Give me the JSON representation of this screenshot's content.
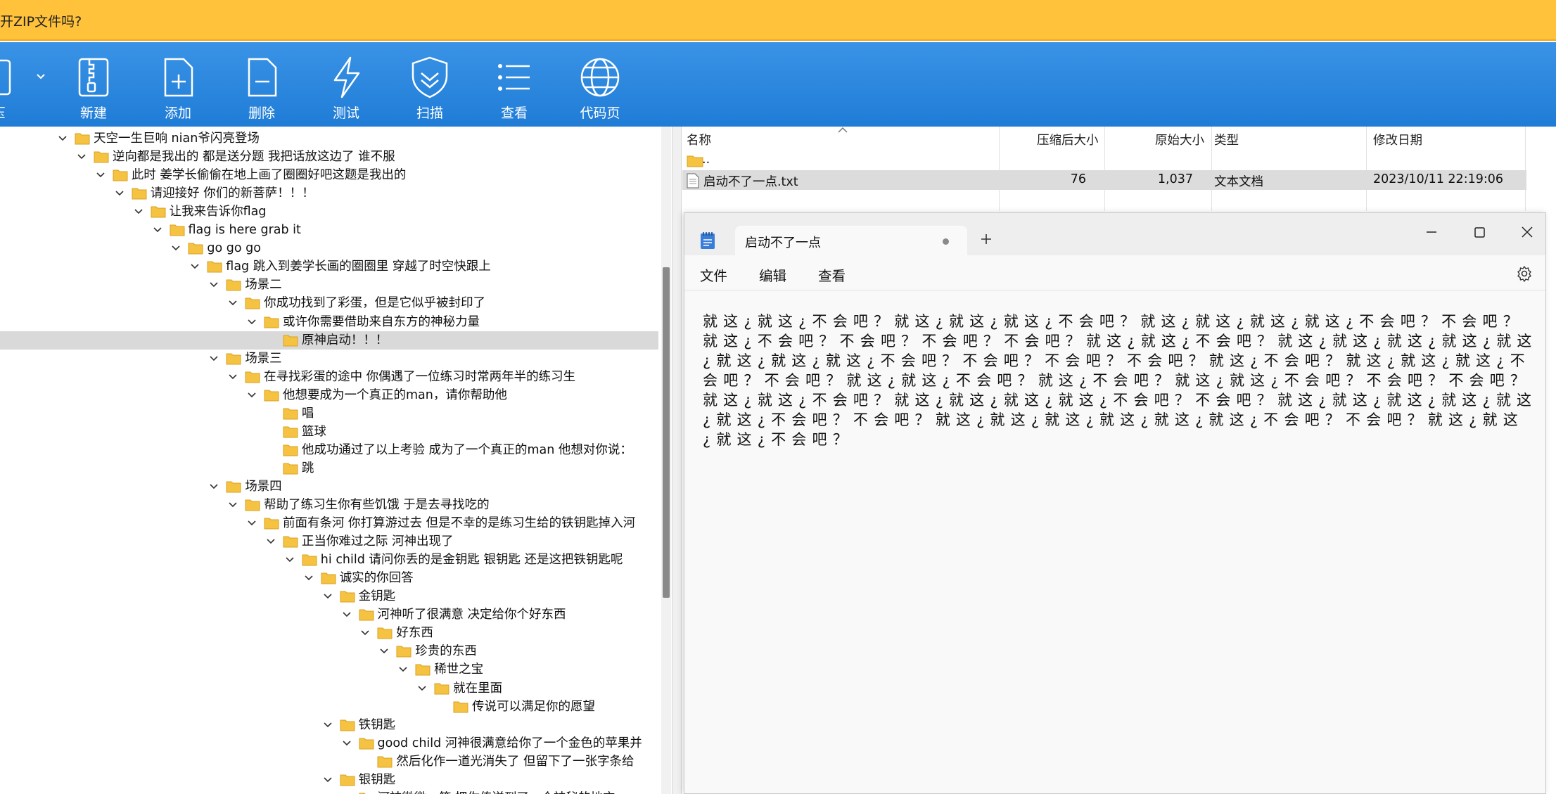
{
  "prompt": {
    "text": "开ZIP文件吗?"
  },
  "toolbar": {
    "buttons": [
      {
        "label": "压",
        "icon": "extract-icon"
      },
      {
        "label": "新建",
        "icon": "zip-archive-icon"
      },
      {
        "label": "添加",
        "icon": "add-file-icon"
      },
      {
        "label": "删除",
        "icon": "delete-file-icon"
      },
      {
        "label": "测试",
        "icon": "lightning-icon"
      },
      {
        "label": "扫描",
        "icon": "shield-scan-icon"
      },
      {
        "label": "查看",
        "icon": "list-view-icon"
      },
      {
        "label": "代码页",
        "icon": "globe-icon"
      }
    ]
  },
  "tree": {
    "items": [
      {
        "label": "天空一生巨响 nian爷闪亮登场",
        "level": 0,
        "expanded": true
      },
      {
        "label": "逆向都是我出的 都是送分题 我把话放这边了 谁不服",
        "level": 1,
        "expanded": true
      },
      {
        "label": "此时 姜学长偷偷在地上画了圈圈好吧这题是我出的",
        "level": 2,
        "expanded": true
      },
      {
        "label": "请迎接好 你们的新菩萨！！！",
        "level": 3,
        "expanded": true
      },
      {
        "label": "让我来告诉你flag",
        "level": 4,
        "expanded": true
      },
      {
        "label": "flag is here grab it",
        "level": 5,
        "expanded": true
      },
      {
        "label": "go go go",
        "level": 6,
        "expanded": true
      },
      {
        "label": "flag 跳入到姜学长画的圈圈里 穿越了时空快跟上",
        "level": 7,
        "expanded": true
      },
      {
        "label": "场景二",
        "level": 8,
        "expanded": true
      },
      {
        "label": "你成功找到了彩蛋，但是它似乎被封印了",
        "level": 9,
        "expanded": true
      },
      {
        "label": "或许你需要借助来自东方的神秘力量",
        "level": 10,
        "expanded": true
      },
      {
        "label": "原神启动！！！",
        "level": 11,
        "expanded": null,
        "selected": true
      },
      {
        "label": "场景三",
        "level": 8,
        "expanded": true
      },
      {
        "label": "在寻找彩蛋的途中 你偶遇了一位练习时常两年半的练习生",
        "level": 9,
        "expanded": true
      },
      {
        "label": "他想要成为一个真正的man，请你帮助他",
        "level": 10,
        "expanded": true
      },
      {
        "label": "唱",
        "level": 11,
        "expanded": null
      },
      {
        "label": "篮球",
        "level": 11,
        "expanded": null
      },
      {
        "label": "他成功通过了以上考验 成为了一个真正的man 他想对你说：",
        "level": 11,
        "expanded": null
      },
      {
        "label": "跳",
        "level": 11,
        "expanded": null
      },
      {
        "label": "场景四",
        "level": 8,
        "expanded": true
      },
      {
        "label": "帮助了练习生你有些饥饿 于是去寻找吃的",
        "level": 9,
        "expanded": true
      },
      {
        "label": "前面有条河 你打算游过去 但是不幸的是练习生给的铁钥匙掉入河",
        "level": 10,
        "expanded": true
      },
      {
        "label": "正当你难过之际 河神出现了",
        "level": 11,
        "expanded": true
      },
      {
        "label": "hi child  请问你丢的是金钥匙 银钥匙 还是这把铁钥匙呢",
        "level": 12,
        "expanded": true
      },
      {
        "label": "诚实的你回答",
        "level": 13,
        "expanded": true
      },
      {
        "label": "金钥匙",
        "level": 14,
        "expanded": true
      },
      {
        "label": "河神听了很满意 决定给你个好东西",
        "level": 15,
        "expanded": true
      },
      {
        "label": "好东西",
        "level": 16,
        "expanded": true
      },
      {
        "label": "珍贵的东西",
        "level": 17,
        "expanded": true
      },
      {
        "label": "稀世之宝",
        "level": 18,
        "expanded": true
      },
      {
        "label": "就在里面",
        "level": 19,
        "expanded": true
      },
      {
        "label": "传说可以满足你的愿望",
        "level": 20,
        "expanded": null
      },
      {
        "label": "铁钥匙",
        "level": 14,
        "expanded": true
      },
      {
        "label": "good child 河神很满意给你了一个金色的苹果并",
        "level": 15,
        "expanded": true
      },
      {
        "label": "然后化作一道光消失了 但留下了一张字条给",
        "level": 16,
        "expanded": null
      },
      {
        "label": "银钥匙",
        "level": 14,
        "expanded": true
      },
      {
        "label": "河神微微一笑 把你传送到了一个神秘的地方",
        "level": 15,
        "expanded": true
      }
    ]
  },
  "filelist": {
    "columns": {
      "name": "名称",
      "packed": "压缩后大小",
      "size": "原始大小",
      "type": "类型",
      "modified": "修改日期"
    },
    "rows": [
      {
        "name": "..",
        "packed": "",
        "size": "",
        "type": "",
        "modified": "",
        "icon": "folder-icon"
      },
      {
        "name": "启动不了一点.txt",
        "packed": "76",
        "size": "1,037",
        "type": "文本文档",
        "modified": "2023/10/11 22:19:06",
        "icon": "text-file-icon",
        "selected": true
      }
    ]
  },
  "notepad": {
    "tab_title": "启动不了一点",
    "menu": {
      "file": "文件",
      "edit": "编辑",
      "view": "查看"
    },
    "content": "就这¿就这¿不会吧？就这¿就这¿就这¿不会吧？就这¿就这¿就这¿就这¿不会吧？不会吧？就这¿不会吧？不会吧？不会吧？不会吧？就这¿就这¿不会吧？就这¿就这¿就这¿就这¿就这¿就这¿就这¿就这¿不会吧？不会吧？不会吧？不会吧？就这¿不会吧？就这¿就这¿就这¿不会吧？不会吧？就这¿就这¿不会吧？就这¿不会吧？就这¿就这¿不会吧？不会吧？不会吧？就这¿就这¿不会吧？就这¿就这¿就这¿就这¿不会吧？不会吧？就这¿就这¿就这¿就这¿就这¿就这¿不会吧？不会吧？就这¿就这¿就这¿就这¿就这¿就这¿不会吧？不会吧？就这¿就这¿就这¿不会吧？"
  },
  "colors": {
    "prompt_bar": "#ffc23a",
    "toolbar": "#1f7cd6",
    "folder": "#f5c242",
    "selection": "#d9d9d9"
  }
}
